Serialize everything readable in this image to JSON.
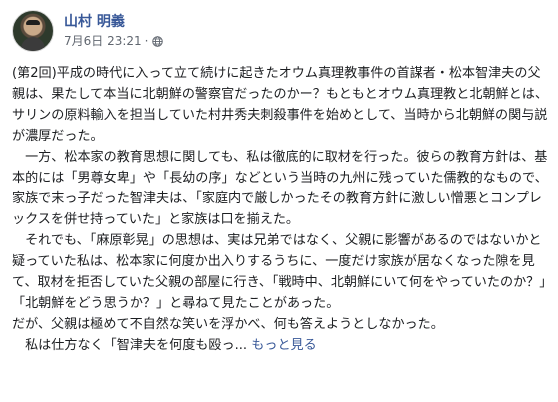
{
  "post": {
    "author": "山村 明義",
    "timestamp": "7月6日 23:21",
    "separator": "·",
    "visibility_icon": "globe-icon",
    "paragraphs": [
      "(第2回)平成の時代に入って立て続けに起きたオウム真理教事件の首謀者・松本智津夫の父親は、果たして本当に北朝鮮の警察官だったのかー？もともとオウム真理教と北朝鮮とは、サリンの原料輸入を担当していた村井秀夫刺殺事件を始めとして、当時から北朝鮮の関与説が濃厚だった。",
      "　一方、松本家の教育思想に関しても、私は徹底的に取材を行った。彼らの教育方針は、基本的には「男尊女卑」や「長幼の序」などという当時の九州に残っていた儒教的なもので、家族で末っ子だった智津夫は、「家庭内で厳しかったその教育方針に激しい憎悪とコンプレックスを併せ持っていた」と家族は口を揃えた。",
      "　それでも、「麻原彰晃」の思想は、実は兄弟ではなく、父親に影響があるのではないかと疑っていた私は、松本家に何度か出入りするうちに、一度だけ家族が居なくなった隙を見て、取材を拒否していた父親の部屋に行き、「戦時中、北朝鮮にいて何をやっていたのか？」「北朝鮮をどう思うか？」と尋ねて見たことがあった。",
      "だが、父親は極めて不自然な笑いを浮かべ、何も答えようとしなかった。",
      "　私は仕方なく「智津夫を何度も殴っ"
    ],
    "ellipsis": "...",
    "see_more": "もっと見る"
  },
  "colors": {
    "author": "#385898",
    "link": "#385898",
    "meta": "#616770",
    "text": "#1c1e21"
  }
}
